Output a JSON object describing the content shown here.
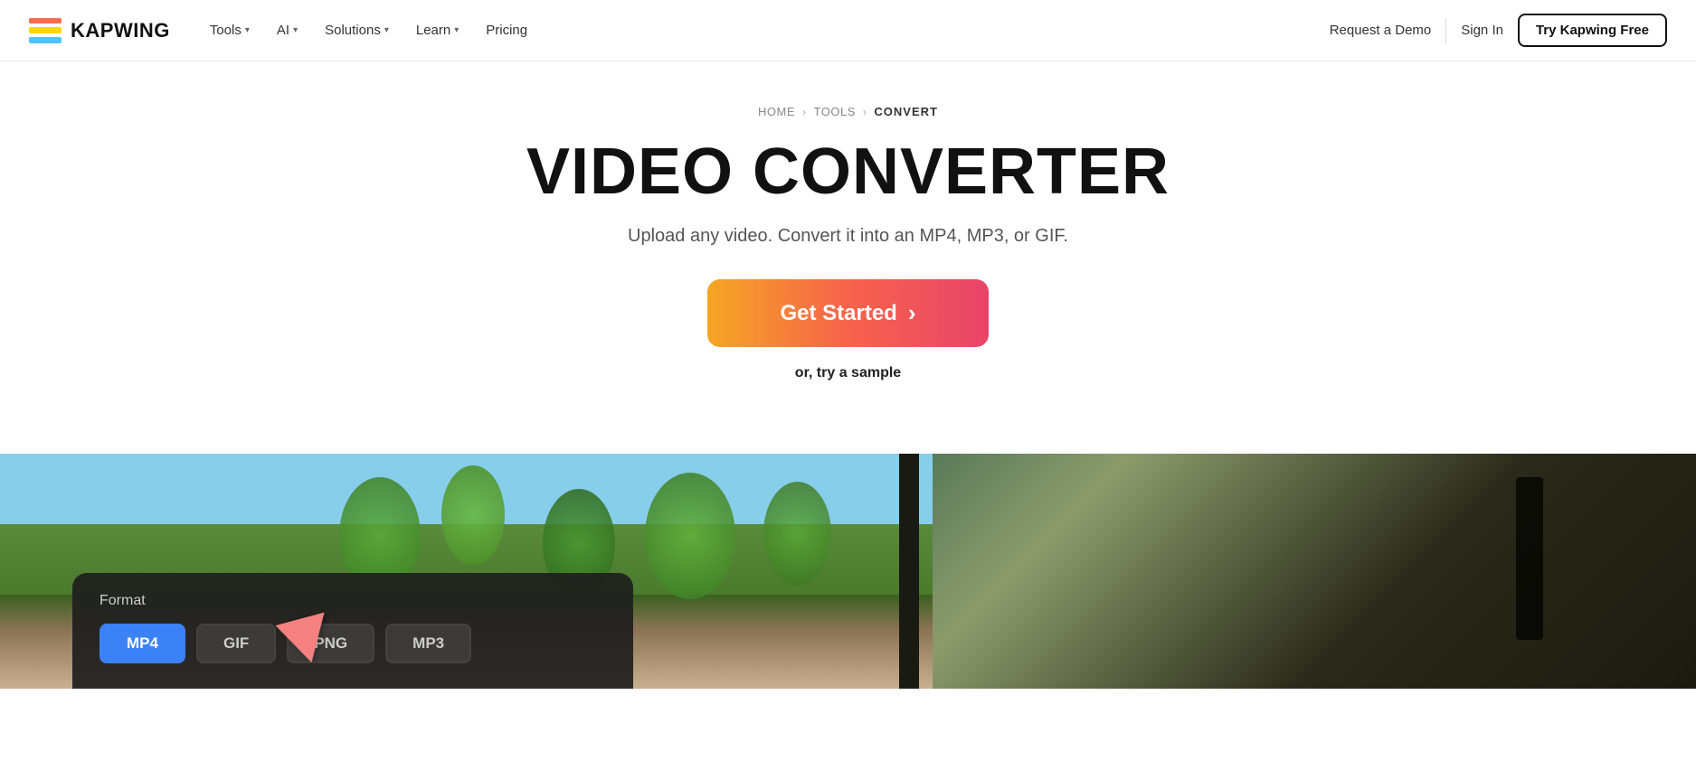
{
  "logo": {
    "text": "KAPWING"
  },
  "nav": {
    "links": [
      {
        "label": "Tools",
        "hasDropdown": true
      },
      {
        "label": "AI",
        "hasDropdown": true
      },
      {
        "label": "Solutions",
        "hasDropdown": true
      },
      {
        "label": "Learn",
        "hasDropdown": true
      },
      {
        "label": "Pricing",
        "hasDropdown": false
      }
    ],
    "request_demo": "Request a Demo",
    "sign_in": "Sign In",
    "try_free": "Try Kapwing Free"
  },
  "breadcrumb": {
    "home": "HOME",
    "tools": "TOOLS",
    "current": "CONVERT"
  },
  "hero": {
    "title": "VIDEO CONVERTER",
    "subtitle": "Upload any video. Convert it into an MP4, MP3, or GIF.",
    "cta_label": "Get Started",
    "cta_arrow": "›",
    "try_sample": "or, try a sample"
  },
  "format_panel": {
    "label": "Format",
    "buttons": [
      {
        "label": "MP4",
        "active": true
      },
      {
        "label": "GIF",
        "active": false
      },
      {
        "label": "PNG",
        "active": false
      },
      {
        "label": "MP3",
        "active": false
      }
    ]
  }
}
